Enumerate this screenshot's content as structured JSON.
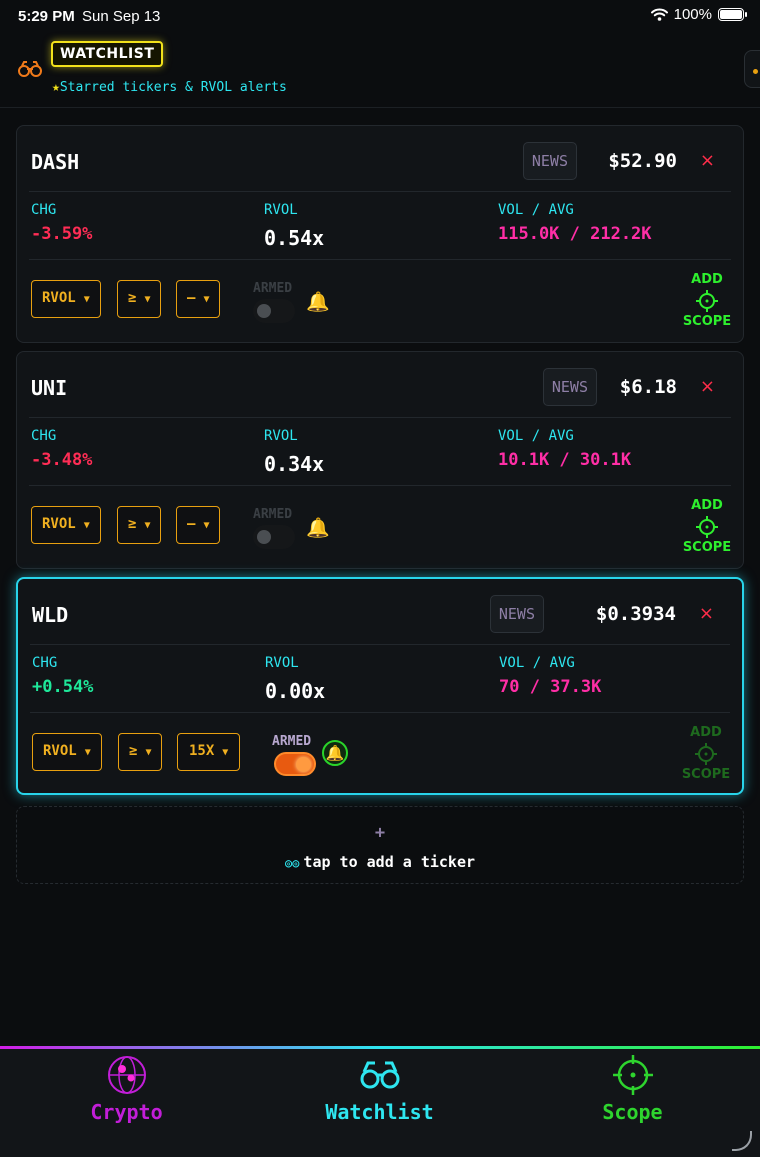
{
  "status_bar": {
    "time": "5:29 PM",
    "date": "Sun Sep 13",
    "battery": "100%"
  },
  "header": {
    "icon": "binoculars-icon",
    "title": "WATCHLIST",
    "star": "★",
    "subtitle": "Starred tickers & RVOL alerts"
  },
  "labels": {
    "news": "NEWS",
    "chg": "CHG",
    "rvol": "RVOL",
    "vol_avg": "VOL / AVG",
    "armed": "ARMED",
    "add": "ADD",
    "scope": "SCOPE",
    "close": "×",
    "caret": "▼"
  },
  "tickers": [
    {
      "symbol": "DASH",
      "price": "$52.90",
      "chg": "-3.59%",
      "rvol": "0.54x",
      "vol_avg": "115.0K / 212.2K",
      "filter_metric": "RVOL",
      "filter_op": "≥",
      "filter_value": "—",
      "armed": false
    },
    {
      "symbol": "UNI",
      "price": "$6.18",
      "chg": "-3.48%",
      "rvol": "0.34x",
      "vol_avg": "10.1K / 30.1K",
      "filter_metric": "RVOL",
      "filter_op": "≥",
      "filter_value": "—",
      "armed": false
    },
    {
      "symbol": "WLD",
      "price": "$0.3934",
      "chg": "+0.54%",
      "rvol": "0.00x",
      "vol_avg": "70 / 37.3K",
      "filter_metric": "RVOL",
      "filter_op": "≥",
      "filter_value": "15X",
      "armed": true
    }
  ],
  "add_ticker": {
    "plus": "+",
    "text": "tap to add a ticker"
  },
  "tabs": [
    {
      "label": "Crypto",
      "icon": "globe-icon",
      "color": "#c21ed8"
    },
    {
      "label": "Watchlist",
      "icon": "binoculars-icon",
      "color": "#2ee6f0"
    },
    {
      "label": "Scope",
      "icon": "crosshair-icon",
      "color": "#2ed42e"
    }
  ],
  "colors": {
    "accent_cyan": "#2ee6f0",
    "accent_yellow": "#f2e21b",
    "negative": "#ff2d55",
    "positive": "#1ee89a",
    "volume": "#ff2ea6",
    "control": "#e8a010"
  }
}
